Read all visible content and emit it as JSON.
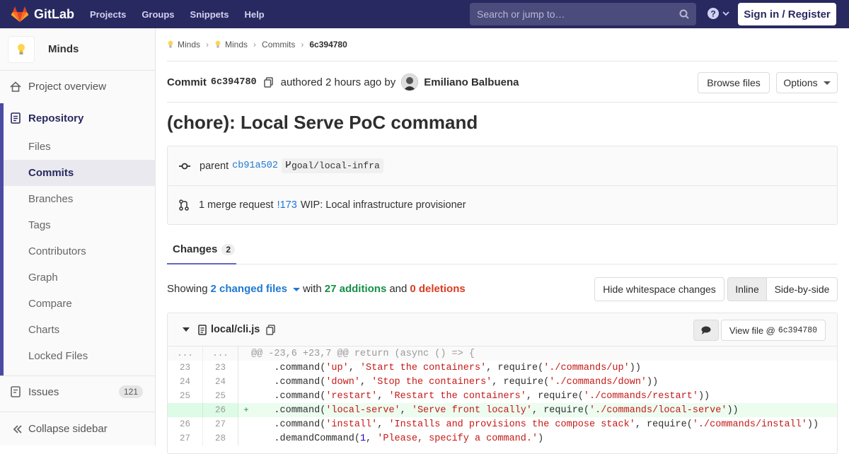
{
  "navbar": {
    "brand": "GitLab",
    "links": [
      "Projects",
      "Groups",
      "Snippets",
      "Help"
    ],
    "search_placeholder": "Search or jump to…",
    "signin_label": "Sign in / Register",
    "bg_color": "#292961"
  },
  "sidebar": {
    "project_name": "Minds",
    "overview": "Project overview",
    "repository": "Repository",
    "sub_items": [
      "Files",
      "Commits",
      "Branches",
      "Tags",
      "Contributors",
      "Graph",
      "Compare",
      "Charts",
      "Locked Files"
    ],
    "active_sub": "Commits",
    "issues": "Issues",
    "issues_count": "121",
    "collapse": "Collapse sidebar"
  },
  "breadcrumbs": {
    "items": [
      "Minds",
      "Minds",
      "Commits"
    ],
    "current": "6c394780"
  },
  "commit": {
    "label": "Commit",
    "sha": "6c394780",
    "authored_text": "authored 2 hours ago by",
    "author": "Emiliano Balbuena",
    "browse_files": "Browse files",
    "options": "Options",
    "title": "(chore): Local Serve PoC command",
    "parent_label": "parent",
    "parent_sha": "cb91a502",
    "branch": "goal/local-infra",
    "merge_text": "1 merge request",
    "merge_id": "!173",
    "merge_title": "WIP: Local infrastructure provisioner"
  },
  "changes": {
    "tab_label": "Changes",
    "tab_count": "2",
    "showing": "Showing",
    "files_changed": "2 changed files",
    "with": "with",
    "additions": "27 additions",
    "and": "and",
    "deletions": "0 deletions",
    "hide_ws": "Hide whitespace changes",
    "inline": "Inline",
    "side_by_side": "Side-by-side"
  },
  "file": {
    "name": "local/cli.js",
    "view_file_label": "View file @",
    "view_file_sha": "6c394780",
    "lines": [
      {
        "type": "match",
        "old": "...",
        "new": "...",
        "sign": "",
        "code": "@@ -23,6 +23,7 @@ return (async () => {"
      },
      {
        "type": "ctx",
        "old": "23",
        "new": "23",
        "sign": "",
        "code": "    .command('up', 'Start the containers', require('./commands/up'))"
      },
      {
        "type": "ctx",
        "old": "24",
        "new": "24",
        "sign": "",
        "code": "    .command('down', 'Stop the containers', require('./commands/down'))"
      },
      {
        "type": "ctx",
        "old": "25",
        "new": "25",
        "sign": "",
        "code": "    .command('restart', 'Restart the containers', require('./commands/restart'))"
      },
      {
        "type": "add",
        "old": "",
        "new": "26",
        "sign": "+",
        "code": "    .command('local-serve', 'Serve front locally', require('./commands/local-serve'))"
      },
      {
        "type": "ctx",
        "old": "26",
        "new": "27",
        "sign": "",
        "code": "    .command('install', 'Installs and provisions the compose stack', require('./commands/install'))"
      },
      {
        "type": "ctx",
        "old": "27",
        "new": "28",
        "sign": "",
        "code": "    .demandCommand(1, 'Please, specify a command.')"
      }
    ]
  }
}
